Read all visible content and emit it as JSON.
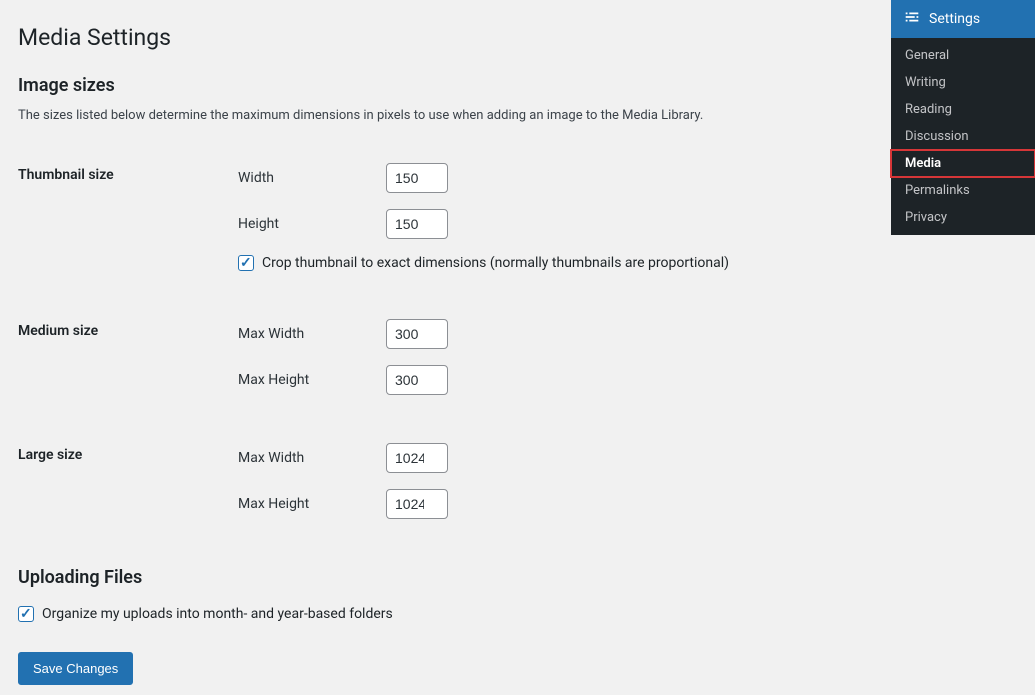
{
  "page": {
    "title": "Media Settings"
  },
  "image_sizes": {
    "heading": "Image sizes",
    "description": "The sizes listed below determine the maximum dimensions in pixels to use when adding an image to the Media Library."
  },
  "thumbnail": {
    "row_label": "Thumbnail size",
    "width_label": "Width",
    "width_value": "150",
    "height_label": "Height",
    "height_value": "150",
    "crop_label": "Crop thumbnail to exact dimensions (normally thumbnails are proportional)",
    "crop_checked": true
  },
  "medium": {
    "row_label": "Medium size",
    "max_width_label": "Max Width",
    "max_width_value": "300",
    "max_height_label": "Max Height",
    "max_height_value": "300"
  },
  "large": {
    "row_label": "Large size",
    "max_width_label": "Max Width",
    "max_width_value": "1024",
    "max_height_label": "Max Height",
    "max_height_value": "1024"
  },
  "uploading": {
    "heading": "Uploading Files",
    "organize_label": "Organize my uploads into month- and year-based folders",
    "organize_checked": true
  },
  "submit": {
    "label": "Save Changes"
  },
  "sidebar": {
    "header": "Settings",
    "items": [
      {
        "label": "General",
        "current": false
      },
      {
        "label": "Writing",
        "current": false
      },
      {
        "label": "Reading",
        "current": false
      },
      {
        "label": "Discussion",
        "current": false
      },
      {
        "label": "Media",
        "current": true,
        "highlight": true
      },
      {
        "label": "Permalinks",
        "current": false
      },
      {
        "label": "Privacy",
        "current": false
      }
    ]
  }
}
